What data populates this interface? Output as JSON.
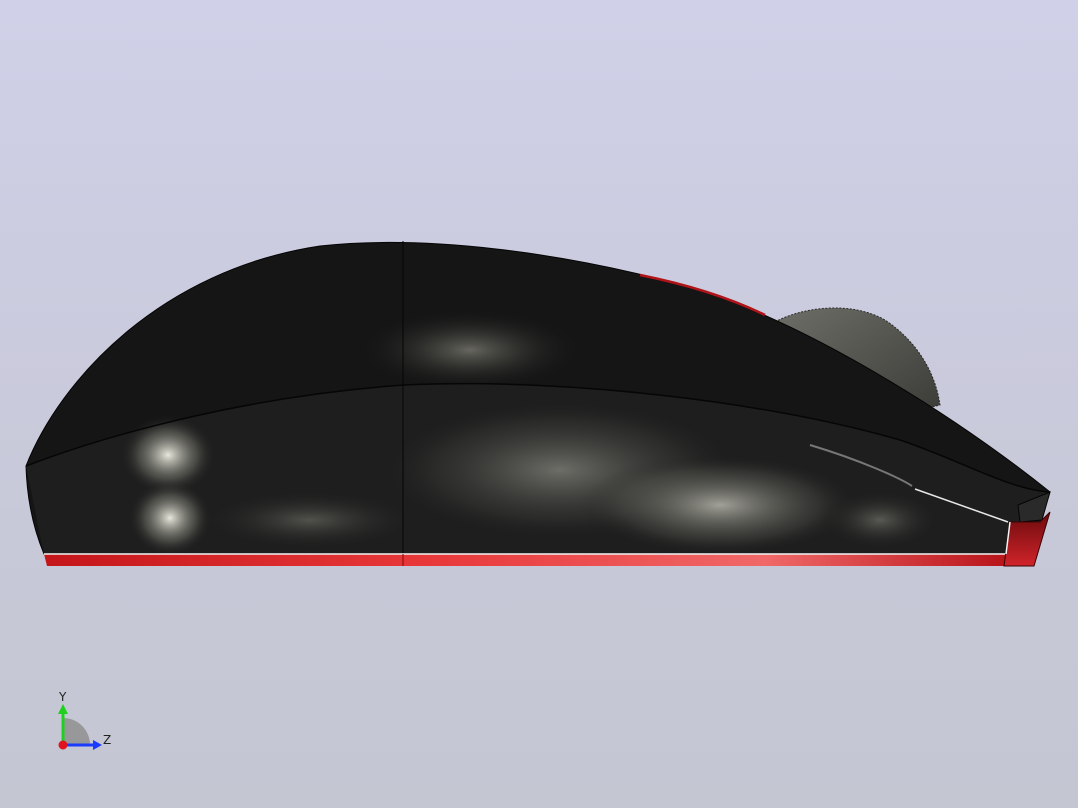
{
  "viewport": {
    "background_top": "#d0d0e8",
    "background_bottom": "#c4c6d2"
  },
  "model": {
    "body_color": "#141414",
    "accent_color": "#e0262a",
    "scroll_wheel_color": "#5a5a55"
  },
  "triad": {
    "y_label": "Y",
    "z_label": "Z",
    "y_color": "#1fd11f",
    "z_color": "#1a3cff",
    "x_color": "#e0141e"
  }
}
